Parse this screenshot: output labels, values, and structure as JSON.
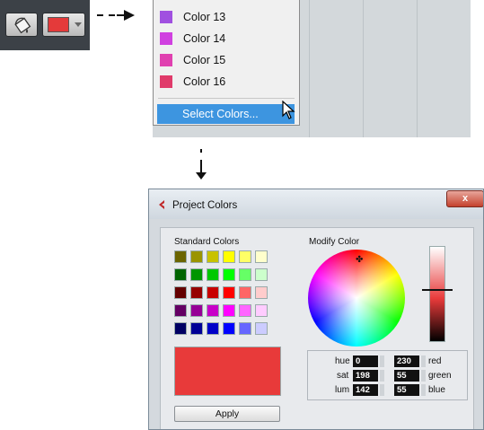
{
  "toolbar": {
    "paint_icon": "paint-bucket-icon",
    "color_button_color": "#e43a3a"
  },
  "menu": {
    "items": [
      {
        "label": "Color 13",
        "color": "#a050e0"
      },
      {
        "label": "Color 14",
        "color": "#d040e0"
      },
      {
        "label": "Color 15",
        "color": "#e040b0"
      },
      {
        "label": "Color 16",
        "color": "#e03a6a"
      }
    ],
    "select_colors": "Select Colors..."
  },
  "dialog": {
    "title": "Project Colors",
    "close_label": "x",
    "standard_colors_label": "Standard Colors",
    "modify_color_label": "Modify Color",
    "apply_label": "Apply",
    "current_color": "#e83a3a",
    "standard_colors": [
      [
        "#6b6500",
        "#9a9400",
        "#c8c200",
        "#ffff00",
        "#ffff66",
        "#ffffcc"
      ],
      [
        "#006400",
        "#009600",
        "#00c800",
        "#00ff00",
        "#66ff66",
        "#ccffcc"
      ],
      [
        "#640000",
        "#960000",
        "#c80000",
        "#ff0000",
        "#ff6666",
        "#ffcccc"
      ],
      [
        "#640064",
        "#960096",
        "#c800c8",
        "#ff00ff",
        "#ff66ff",
        "#ffccff"
      ],
      [
        "#000064",
        "#000096",
        "#0000c8",
        "#0000ff",
        "#6666ff",
        "#ccccff"
      ]
    ],
    "fields": {
      "hue_label": "hue",
      "hue": "0",
      "sat_label": "sat",
      "sat": "198",
      "lum_label": "lum",
      "lum": "142",
      "red_label": "red",
      "red": "230",
      "green_label": "green",
      "green": "55",
      "blue_label": "blue",
      "blue": "55"
    }
  }
}
